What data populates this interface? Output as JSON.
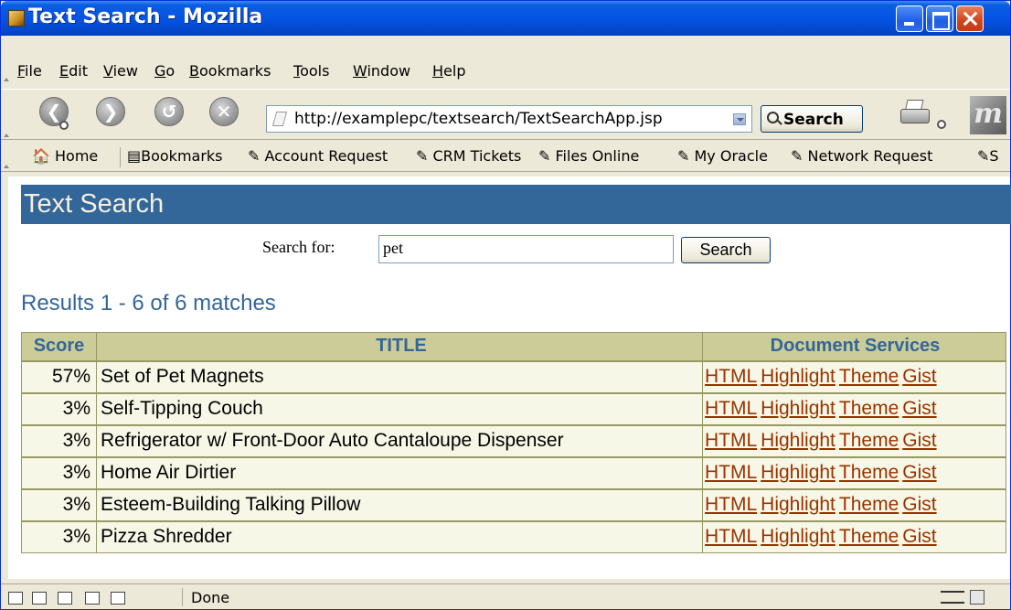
{
  "window": {
    "title": "Text Search - Mozilla"
  },
  "menu": {
    "items": [
      {
        "accel": "F",
        "rest": "ile"
      },
      {
        "accel": "E",
        "rest": "dit"
      },
      {
        "accel": "V",
        "rest": "iew"
      },
      {
        "accel": "G",
        "rest": "o"
      },
      {
        "accel": "B",
        "rest": "ookmarks"
      },
      {
        "accel": "T",
        "rest": "ools"
      },
      {
        "accel": "W",
        "rest": "indow"
      },
      {
        "accel": "H",
        "rest": "elp"
      }
    ]
  },
  "nav": {
    "url": "http://examplepc/textsearch/TextSearchApp.jsp",
    "search_label": "Search"
  },
  "bookmarks": {
    "home": "Home",
    "bookmarks": "Bookmarks",
    "items": [
      "Account Request",
      "CRM Tickets",
      "Files Online",
      "My Oracle",
      "Network Request",
      "S"
    ]
  },
  "page": {
    "header": "Text Search",
    "search_label": "Search for:",
    "search_value": "pet",
    "search_button": "Search",
    "results_title": "Results 1 - 6 of 6 matches",
    "columns": {
      "score": "Score",
      "title": "TITLE",
      "services": "Document Services"
    },
    "services": [
      "HTML",
      "Highlight",
      "Theme",
      "Gist"
    ],
    "rows": [
      {
        "score": "57%",
        "title": "Set of Pet Magnets"
      },
      {
        "score": "3%",
        "title": "Self-Tipping Couch"
      },
      {
        "score": "3%",
        "title": "Refrigerator w/ Front-Door Auto Cantaloupe Dispenser"
      },
      {
        "score": "3%",
        "title": "Home Air Dirtier"
      },
      {
        "score": "3%",
        "title": "Esteem-Building Talking Pillow"
      },
      {
        "score": "3%",
        "title": "Pizza Shredder"
      }
    ]
  },
  "status": {
    "text": "Done"
  },
  "colors": {
    "header_bg": "#336699",
    "header_text": "#f7efde",
    "table_header_bg": "#cccc99",
    "table_row_bg": "#f7f7e7",
    "link": "#993300"
  }
}
